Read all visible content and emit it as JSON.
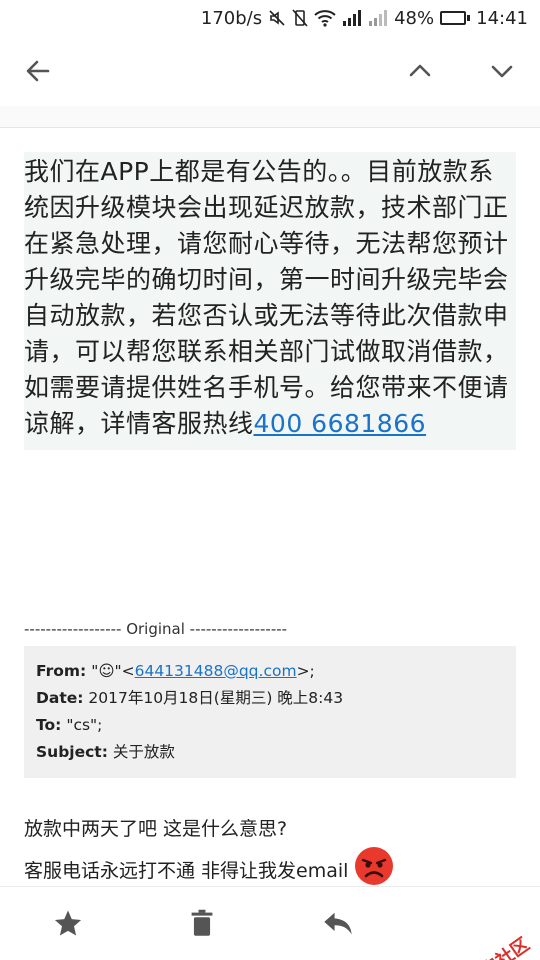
{
  "status_bar": {
    "speed": "170b/s",
    "battery_percent": "48%",
    "battery_level": 0.48,
    "time": "14:41"
  },
  "message": {
    "body": "我们在APP上都是有公告的。。目前放款系统因升级模块会出现延迟放款，技术部门正在紧急处理，请您耐心等待，无法帮您预计升级完毕的确切时间，第一时间升级完毕会自动放款，若您否认或无法等待此次借款申请，可以帮您联系相关部门试做取消借款，如需要请提供姓名手机号。给您带来不便请谅解，详情客服热线",
    "hotline": "400 6681866"
  },
  "original": {
    "separator": "------------------ Original ------------------",
    "from_label": "From:",
    "from_name": "\"☺\"<",
    "from_email": "644131488@qq.com",
    "from_suffix": ">;",
    "date_label": "Date:",
    "date_value": "2017年10月18日(星期三) 晚上8:43",
    "to_label": "To:",
    "to_value": "\"cs\";",
    "subject_label": "Subject:",
    "subject_value": "关于放款"
  },
  "reply": {
    "line1": "放款中两天了吧   这是什么意思?",
    "line2": "客服电话永远打不通  非得让我发email"
  },
  "watermark": {
    "text": "卡农社区"
  },
  "colors": {
    "link": "#1a73c9",
    "battery": "#3ec83e",
    "watermark": "#d9302c"
  }
}
